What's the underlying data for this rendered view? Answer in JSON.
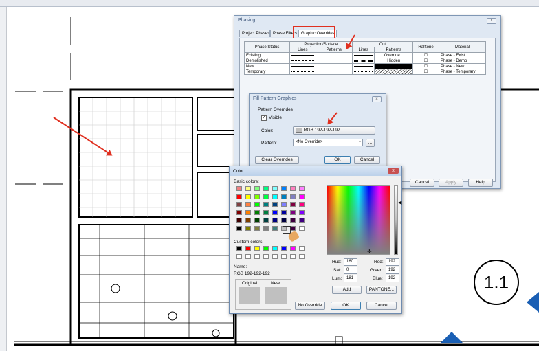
{
  "phasing": {
    "title": "Phasing",
    "close": "x",
    "tabs": [
      "Project Phases",
      "Phase Filters",
      "Graphic Overrides"
    ],
    "headers": {
      "phase_status": "Phase Status",
      "projection": "Projection/Surface",
      "cut": "Cut",
      "lines": "Lines",
      "patterns": "Patterns",
      "halftone": "Halftone",
      "material": "Material"
    },
    "rows": [
      {
        "status": "Existing",
        "cut_patterns": "Override...",
        "material": "Phase - Exist"
      },
      {
        "status": "Demolished",
        "cut_patterns": "Hidden",
        "material": "Phase - Demo"
      },
      {
        "status": "New",
        "cut_patterns": "",
        "material": "Phase - New"
      },
      {
        "status": "Temporary",
        "cut_patterns": "",
        "material": "Phase - Temporary"
      }
    ],
    "buttons": {
      "cancel": "Cancel",
      "apply": "Apply",
      "help": "Help"
    }
  },
  "fill": {
    "title": "Fill Pattern Graphics",
    "close": "x",
    "group": "Pattern Overrides",
    "visible": "Visible",
    "color_label": "Color:",
    "color_value": "RGB 192-192-192",
    "pattern_label": "Pattern:",
    "pattern_value": "<No Override>",
    "browse": "...",
    "clear": "Clear Overrides",
    "ok": "OK",
    "cancel": "Cancel"
  },
  "color": {
    "title": "Color",
    "close": "x",
    "basic": "Basic colors:",
    "custom": "Custom colors:",
    "name_label": "Name:",
    "name_value": "RGB 192-192-192",
    "original": "Original",
    "new": "New",
    "hue_label": "Hue:",
    "hue": "160",
    "sat_label": "Sat:",
    "sat": "0",
    "lum_label": "Lum:",
    "lum": "181",
    "red_label": "Red:",
    "red": "192",
    "green_label": "Green:",
    "green": "192",
    "blue_label": "Blue:",
    "blue": "192",
    "add": "Add",
    "pantone": "PANTONE...",
    "no_override": "No Override",
    "ok": "OK",
    "cancel": "Cancel",
    "basic_colors": [
      "#f08080",
      "#ffff80",
      "#80ff80",
      "#00ff80",
      "#80ffff",
      "#0080ff",
      "#ff80c0",
      "#ff80ff",
      "#ff0000",
      "#ffff00",
      "#80ff00",
      "#00ff40",
      "#00ffff",
      "#0080c0",
      "#8080c0",
      "#ff00ff",
      "#804040",
      "#ff8040",
      "#00ff00",
      "#008080",
      "#004080",
      "#8080ff",
      "#800040",
      "#ff0080",
      "#800000",
      "#ff8000",
      "#008000",
      "#008040",
      "#0000ff",
      "#0000a0",
      "#800080",
      "#8000ff",
      "#400000",
      "#804000",
      "#004000",
      "#004040",
      "#000080",
      "#000040",
      "#400040",
      "#400080",
      "#000000",
      "#808000",
      "#808040",
      "#808080",
      "#408080",
      "#c0c0c0",
      "#400040",
      "#ffffff"
    ],
    "custom_colors": [
      "#000000",
      "#ff0000",
      "#ffff00",
      "#00ff00",
      "#00ffff",
      "#0000ff",
      "#ff00ff",
      "#ffffff"
    ]
  },
  "drawing": {
    "tag": "1.1"
  }
}
